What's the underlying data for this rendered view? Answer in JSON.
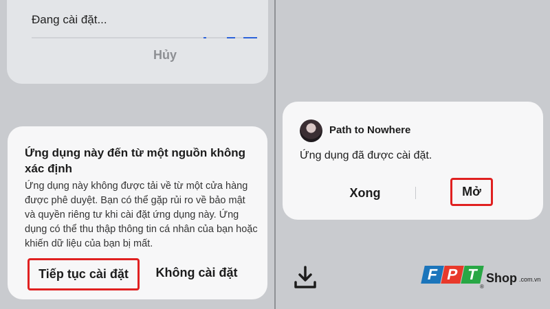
{
  "left_panel": {
    "installing_card": {
      "status": "Đang cài đặt...",
      "progress": 0.9,
      "cancel_label": "Hủy"
    },
    "warning_dialog": {
      "title": "Ứng dụng này đến từ một nguồn không xác định",
      "body": "Ứng dụng này không được tải về từ một cửa hàng được phê duyệt. Bạn có thể gặp rủi ro về bảo mật và quyền riêng tư khi cài đặt ứng dụng này. Ứng dụng có thể thu thập thông tin cá nhân của bạn hoặc khiến dữ liệu của bạn bị mất.",
      "continue_label": "Tiếp tục cài đặt",
      "no_install_label": "Không cài đặt"
    }
  },
  "right_panel": {
    "installed_card": {
      "app_name": "Path to Nowhere",
      "message": "Ứng dụng đã được cài đặt.",
      "done_label": "Xong",
      "open_label": "Mở"
    },
    "download_icon": "download-icon"
  },
  "logo": {
    "letters": [
      "F",
      "P",
      "T"
    ],
    "letter_colors": [
      "#1b75bb",
      "#e8392b",
      "#28a745"
    ],
    "shop": "Shop",
    "suffix": ".com.vn",
    "registered": "®"
  },
  "colors": {
    "highlight": "#e02020",
    "background": "#c9cbcf",
    "card": "#f7f7f8",
    "progress": "#2b62d9"
  }
}
